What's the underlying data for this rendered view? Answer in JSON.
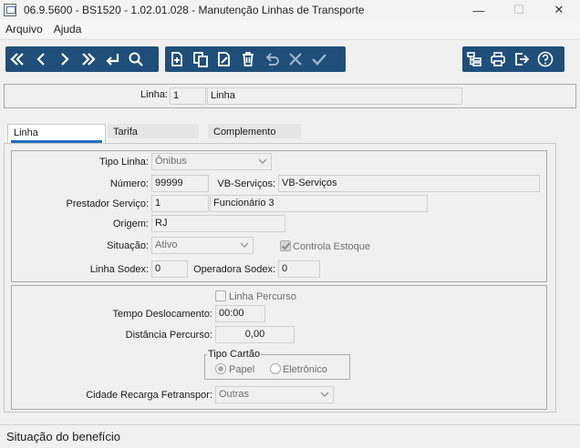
{
  "window": {
    "title": "06.9.5600 - BS1520 - 1.02.01.028 - Manutenção Linhas de Transporte",
    "minimize": "—",
    "maximize": "☐",
    "close": "✕"
  },
  "menu": {
    "items": [
      "Arquivo",
      "Ajuda"
    ]
  },
  "toolbar": {
    "nav": [
      "first-icon",
      "previous-icon",
      "next-icon",
      "last-icon",
      "return-icon",
      "search-icon"
    ],
    "edit": [
      "new-icon",
      "copy-icon",
      "edit-icon",
      "delete-icon",
      "undo-icon",
      "cancel-icon",
      "confirm-icon"
    ],
    "extra": [
      "tree-icon",
      "print-icon",
      "exit-icon",
      "help-icon"
    ],
    "accent": "#1f4e79"
  },
  "header": {
    "linha_label": "Linha:",
    "linha_code": "1",
    "linha_name": "Linha"
  },
  "tabs": [
    {
      "label": "Linha",
      "active": true
    },
    {
      "label": "Tarifa",
      "active": false
    },
    {
      "label": "Complemento",
      "active": false
    }
  ],
  "form": {
    "tipo_linha_label": "Tipo Linha:",
    "tipo_linha_value": "Ônibus",
    "numero_label": "Número:",
    "numero_value": "99999",
    "vb_servicos_label": "VB-Serviços:",
    "vb_servicos_value": "VB-Serviços",
    "prestador_label": "Prestador Serviço:",
    "prestador_code": "1",
    "prestador_name": "Funcionário 3",
    "origem_label": "Origem:",
    "origem_value": "RJ",
    "situacao_label": "Situação:",
    "situacao_value": "Ativo",
    "controla_estoque_label": "Controla Estoque",
    "controla_estoque_checked": true,
    "linha_sodex_label": "Linha Sodex:",
    "linha_sodex_value": "0",
    "operadora_sodex_label": "Operadora Sodex:",
    "operadora_sodex_value": "0"
  },
  "percurso": {
    "linha_percurso_label": "Linha Percurso",
    "linha_percurso_checked": false,
    "tempo_label": "Tempo Deslocamento:",
    "tempo_value": "00:00",
    "distancia_label": "Distância Percurso:",
    "distancia_value": "0,00",
    "tipo_cartao_legend": "Tipo Cartão",
    "papel_label": "Papel",
    "papel_selected": true,
    "eletronico_label": "Eletrônico",
    "eletronico_selected": false,
    "cidade_label": "Cidade Recarga Fetranspor:",
    "cidade_value": "Outras"
  },
  "status": {
    "text": "Situação do benefício"
  }
}
